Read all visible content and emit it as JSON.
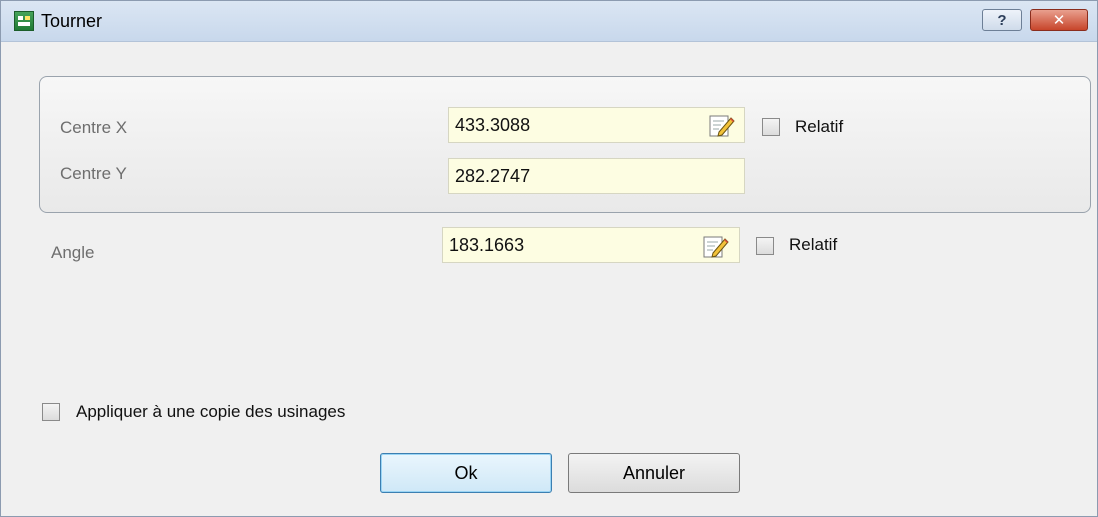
{
  "window": {
    "title": "Tourner",
    "help_button": "?",
    "close_button": "✕"
  },
  "center_group": {
    "centre_x": {
      "label": "Centre X",
      "value": "433.3088",
      "relative_label": "Relatif",
      "relative_checked": false
    },
    "centre_y": {
      "label": "Centre Y",
      "value": "282.2747"
    }
  },
  "angle": {
    "label": "Angle",
    "value": "183.1663",
    "relative_label": "Relatif",
    "relative_checked": false
  },
  "apply_copy": {
    "label": "Appliquer à une copie des usinages",
    "checked": false
  },
  "buttons": {
    "ok": "Ok",
    "cancel": "Annuler"
  },
  "icons": {
    "app": "app-icon",
    "picker": "edit-pencil-icon"
  }
}
